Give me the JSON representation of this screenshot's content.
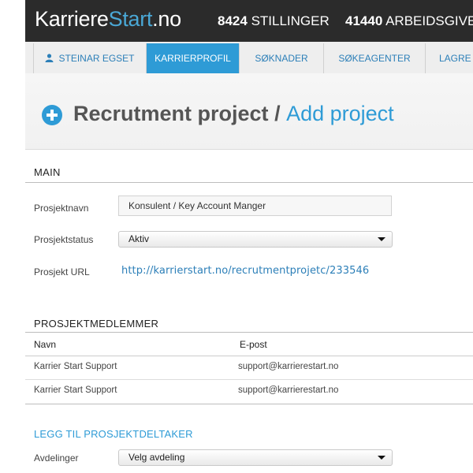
{
  "topbar": {
    "logo_part1": "Karriere",
    "logo_part2": "Start",
    "logo_part3": ".no",
    "stat1_number": "8424",
    "stat1_label": "STILLINGER",
    "stat2_number": "41440",
    "stat2_label": "ARBEIDSGIVE"
  },
  "nav": {
    "items": [
      {
        "label": "STEINAR EGSET"
      },
      {
        "label": "KARRIERPROFIL"
      },
      {
        "label": "SØKNADER"
      },
      {
        "label": "SØKEAGENTER"
      },
      {
        "label": "LAGRE"
      }
    ]
  },
  "header": {
    "title": "Recrutment project",
    "slash": " / ",
    "subtitle": "Add project"
  },
  "main": {
    "heading": "MAIN",
    "name_label": "Prosjektnavn",
    "name_value": "Konsulent / Key Account Manger",
    "status_label": "Prosjektstatus",
    "status_value": "Aktiv",
    "url_label": "Prosjekt URL",
    "url_value": "http://karrierstart.no/recrutmentprojetc/233546"
  },
  "members": {
    "heading": "PROSJEKTMEDLEMMER",
    "col_name": "Navn",
    "col_email": "E-post",
    "rows": [
      {
        "name": "Karrier Start Support",
        "email": "support@karrierestart.no"
      },
      {
        "name": "Karrier Start Support",
        "email": "support@karrierestart.no"
      }
    ]
  },
  "add": {
    "heading": "LEGG TIL PROSJEKTDELTAKER",
    "dept_label": "Avdelinger",
    "dept_value": "Velg avdeling"
  },
  "colors": {
    "accent": "#2e9bd6",
    "topbar": "#2b2b2b",
    "link": "#2c7fb8"
  }
}
